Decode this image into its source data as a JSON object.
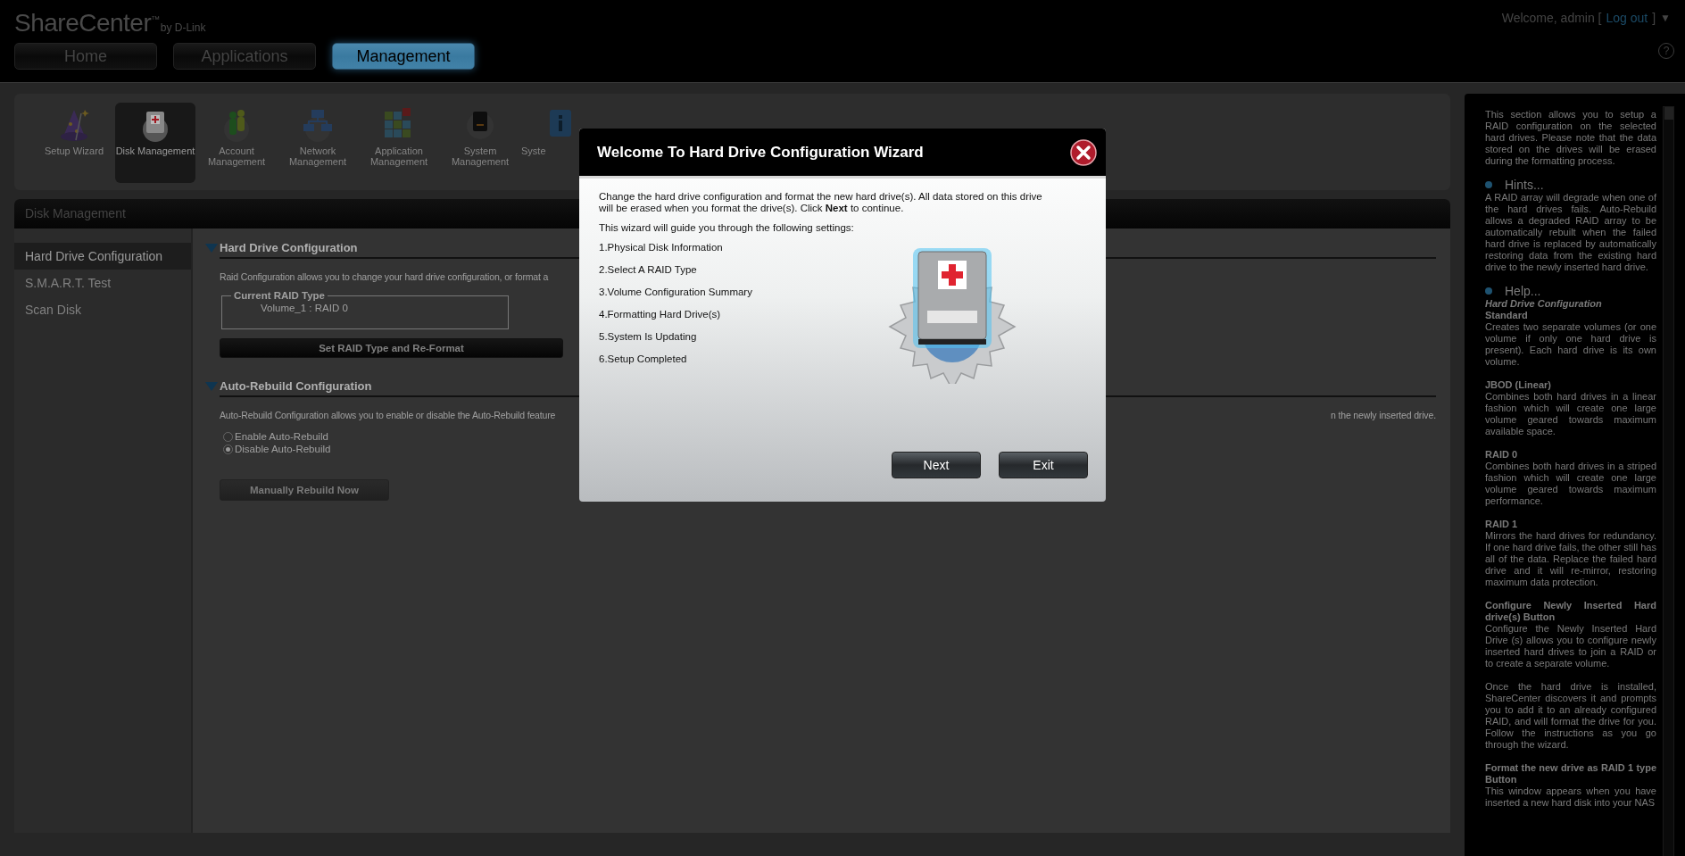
{
  "header": {
    "logo": "ShareCenter$^{™}$",
    "byline": "by D-Link",
    "welcome": "Welcome, admin [",
    "logout": "Log out",
    "welcome_end": "]",
    "caret": "▼",
    "help": "?"
  },
  "tabs": [
    {
      "label": "Home",
      "selected": false
    },
    {
      "label": "Applications",
      "selected": false
    },
    {
      "label": "Management",
      "selected": true
    }
  ],
  "tools": [
    {
      "kind": "wizard",
      "label": "Setup Wizard",
      "selected": false
    },
    {
      "kind": "disk",
      "label": "Disk Management",
      "selected": true
    },
    {
      "kind": "account",
      "label": "Account Management",
      "selected": false
    },
    {
      "kind": "network",
      "label": "Network Management",
      "selected": false
    },
    {
      "kind": "application",
      "label": "Application Management",
      "selected": false
    },
    {
      "kind": "system",
      "label": "System Management",
      "selected": false
    },
    {
      "kind": "info",
      "label": "Syste",
      "selected": false
    }
  ],
  "panel": {
    "title": "Disk Management",
    "nav": [
      {
        "label": "Hard Drive Configuration",
        "selected": true
      },
      {
        "label": "S.M.A.R.T. Test",
        "selected": false
      },
      {
        "label": "Scan Disk",
        "selected": false
      }
    ],
    "hard_drive": {
      "title": "Hard Drive Configuration",
      "description": "Raid Configuration allows you to change your hard drive configuration, or format a",
      "legend": "Current RAID Type",
      "value": "Volume_1 : RAID 0",
      "button": {
        "label": "Set RAID Type and Re-Format",
        "disabled": false
      }
    },
    "auto_rebuild": {
      "title": "Auto-Rebuild Configuration",
      "description": "Auto-Rebuild Configuration allows you to enable or disable the Auto-Rebuild feature",
      "description_end": "n the newly inserted drive.",
      "options": [
        {
          "label": "Enable Auto-Rebuild",
          "selected": false
        },
        {
          "label": "Disable Auto-Rebuild",
          "selected": true
        }
      ],
      "button": {
        "label": "Manually Rebuild Now",
        "disabled": true
      }
    }
  },
  "help": {
    "intro": "This section allows you to setup a RAID configuration on the selected hard drives. Please note that the data stored on the drives will be erased during the formatting process.",
    "hints_title": "Hints...",
    "hints": "A RAID array will degrade when one of the hard drives fails. Auto-Rebuild allows a degraded RAID array to be automatically rebuilt when the failed hard drive is replaced by automatically restoring data from the existing hard drive to the newly inserted hard drive.",
    "help_title": "Help...",
    "subtitle": "Hard Drive Configuration",
    "entries": [
      {
        "term": "Standard",
        "paragraphs": [
          "Creates two separate volumes (or one volume if only one hard drive is present). Each hard drive is its own volume."
        ]
      },
      {
        "term": "JBOD (Linear)",
        "paragraphs": [
          "Combines both hard drives in a linear fashion which will create one large volume geared towards maximum available space."
        ]
      },
      {
        "term": "RAID 0",
        "paragraphs": [
          "Combines both hard drives in a striped fashion which will create one large volume geared towards maximum performance."
        ]
      },
      {
        "term": "RAID 1",
        "paragraphs": [
          "Mirrors the hard drives for redundancy. If one hard drive fails, the other still has all of the data. Replace the failed hard drive and it will re-mirror, restoring maximum data protection."
        ]
      },
      {
        "term": "Configure Newly Inserted Hard drive(s) Button",
        "paragraphs": [
          "Configure the Newly Inserted Hard Drive (s) allows you to configure newly inserted hard drives to join a RAID or to create a separate volume.",
          "Once the hard drive is installed, ShareCenter discovers it and prompts you to add it to an already configured RAID, and will format the drive for you. Follow the instructions as you go through the wizard."
        ]
      },
      {
        "term": "Format the new drive as RAID 1 type Button",
        "paragraphs": [
          "This window appears when you have inserted a new hard disk into your NAS"
        ]
      }
    ]
  },
  "wizard": {
    "title": "Welcome To Hard Drive Configuration Wizard",
    "intro": "Change the hard drive configuration and format the new hard drive(s). All data stored on this drive will be erased when you format the drive(s). Click **Next** to continue.",
    "guide": "This wizard will guide you through the following settings:",
    "steps": [
      "1.Physical Disk Information",
      "2.Select A RAID Type",
      "3.Volume Configuration Summary",
      "4.Formatting Hard Drive(s)",
      "5.System Is Updating",
      "6.Setup Completed"
    ],
    "buttons": [
      "Next",
      "Exit"
    ]
  }
}
